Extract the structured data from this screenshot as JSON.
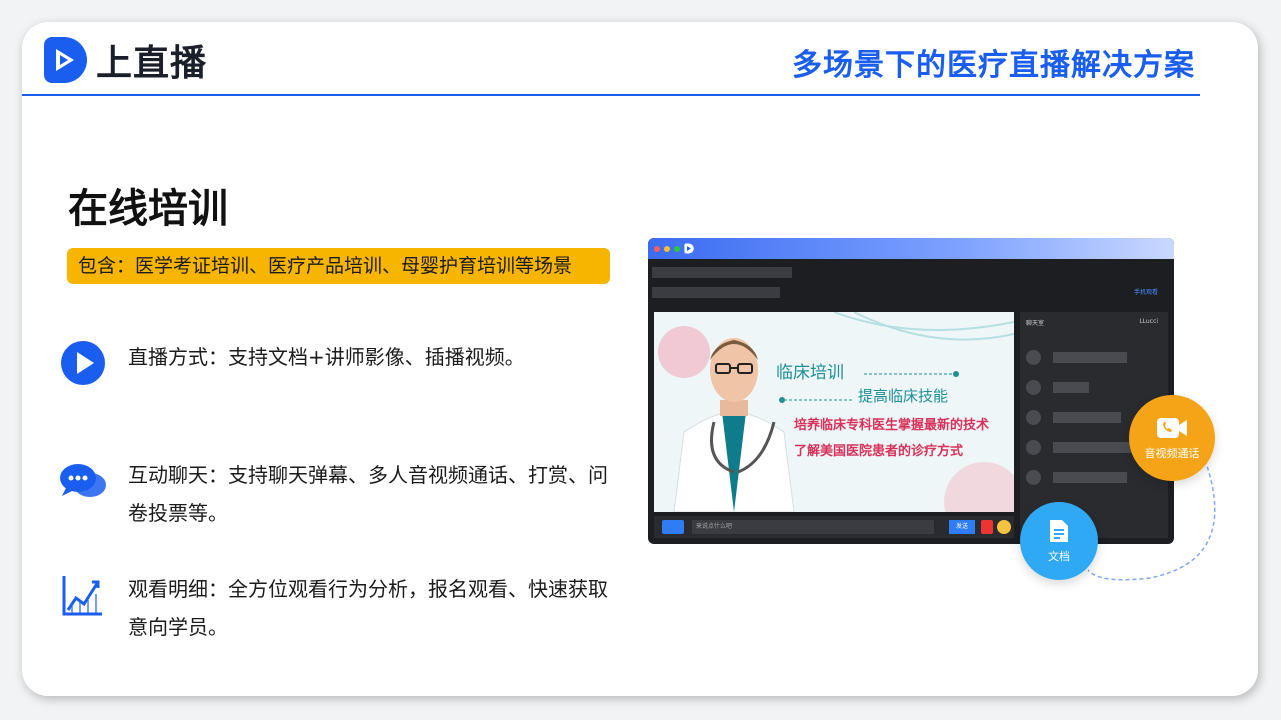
{
  "brand": {
    "name": "上直播",
    "color": "#1a5ef0"
  },
  "header": {
    "headline": "多场景下的医疗直播解决方案"
  },
  "section": {
    "title": "在线培训",
    "tag": "包含：医学考证培训、医疗产品培训、母婴护育培训等场景"
  },
  "features": [
    {
      "icon": "play-icon",
      "text": "直播方式：支持文档+讲师影像、插播视频。"
    },
    {
      "icon": "chat-bubbles-icon",
      "text": "互动聊天：支持聊天弹幕、多人音视频通话、打赏、问卷投票等。"
    },
    {
      "icon": "analytics-chart-icon",
      "text": "观看明细：全方位观看行为分析，报名观看、快速获取意向学员。"
    }
  ],
  "screenshot": {
    "top_right_label": "手机观看",
    "chat_header": "聊天室",
    "chat_user": "LLucci",
    "input_placeholder": "来说点什么吧",
    "send_label": "发送",
    "slide": {
      "title": "临床培训",
      "subtitle": "提高临床技能",
      "line1": "培养临床专科医生掌握最新的技术",
      "line2": "了解美国医院患者的诊疗方式"
    }
  },
  "callouts": {
    "av_call": "音视频通话",
    "document": "文档"
  }
}
